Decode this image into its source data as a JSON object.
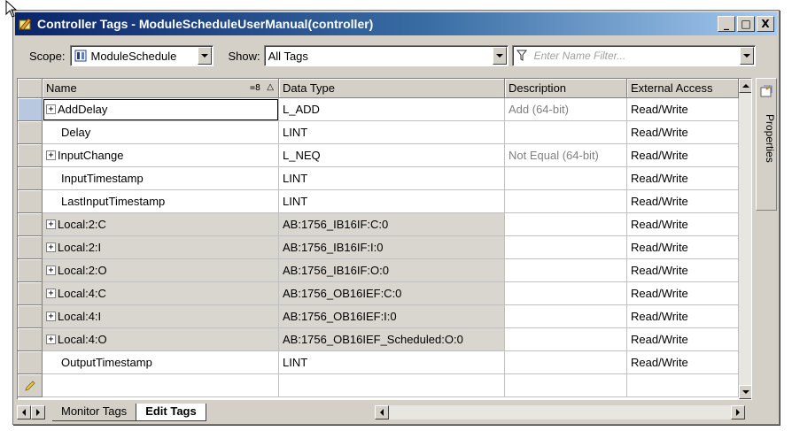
{
  "window": {
    "title": "Controller Tags - ModuleScheduleUserManual(controller)",
    "controls": [
      "_",
      "□",
      "X"
    ]
  },
  "toolbar": {
    "scope_label": "Scope:",
    "scope_value": "ModuleSchedule",
    "show_label": "Show:",
    "show_value": "All Tags",
    "filter_placeholder": "Enter Name Filter..."
  },
  "grid": {
    "columns": [
      "Name",
      "Data Type",
      "Description",
      "External Access"
    ],
    "rows": [
      {
        "name": "AddDelay",
        "expand": true,
        "type": "L_ADD",
        "desc": "Add (64-bit)",
        "access": "Read/Write",
        "alias": false
      },
      {
        "name": "Delay",
        "expand": false,
        "type": "LINT",
        "desc": "",
        "access": "Read/Write",
        "alias": false
      },
      {
        "name": "InputChange",
        "expand": true,
        "type": "L_NEQ",
        "desc": "Not Equal (64-bit)",
        "access": "Read/Write",
        "alias": false
      },
      {
        "name": "InputTimestamp",
        "expand": false,
        "type": "LINT",
        "desc": "",
        "access": "Read/Write",
        "alias": false
      },
      {
        "name": "LastInputTimestamp",
        "expand": false,
        "type": "LINT",
        "desc": "",
        "access": "Read/Write",
        "alias": false
      },
      {
        "name": "Local:2:C",
        "expand": true,
        "type": "AB:1756_IB16IF:C:0",
        "desc": "",
        "access": "Read/Write",
        "alias": true
      },
      {
        "name": "Local:2:I",
        "expand": true,
        "type": "AB:1756_IB16IF:I:0",
        "desc": "",
        "access": "Read/Write",
        "alias": true
      },
      {
        "name": "Local:2:O",
        "expand": true,
        "type": "AB:1756_IB16IF:O:0",
        "desc": "",
        "access": "Read/Write",
        "alias": true
      },
      {
        "name": "Local:4:C",
        "expand": true,
        "type": "AB:1756_OB16IEF:C:0",
        "desc": "",
        "access": "Read/Write",
        "alias": true
      },
      {
        "name": "Local:4:I",
        "expand": true,
        "type": "AB:1756_OB16IEF:I:0",
        "desc": "",
        "access": "Read/Write",
        "alias": true
      },
      {
        "name": "Local:4:O",
        "expand": true,
        "type": "AB:1756_OB16IEF_Scheduled:O:0",
        "desc": "",
        "access": "Read/Write",
        "alias": true
      },
      {
        "name": "OutputTimestamp",
        "expand": false,
        "type": "LINT",
        "desc": "",
        "access": "Read/Write",
        "alias": false
      }
    ]
  },
  "side_panel": {
    "label": "Properties"
  },
  "tabs": {
    "monitor": "Monitor Tags",
    "edit": "Edit Tags"
  }
}
